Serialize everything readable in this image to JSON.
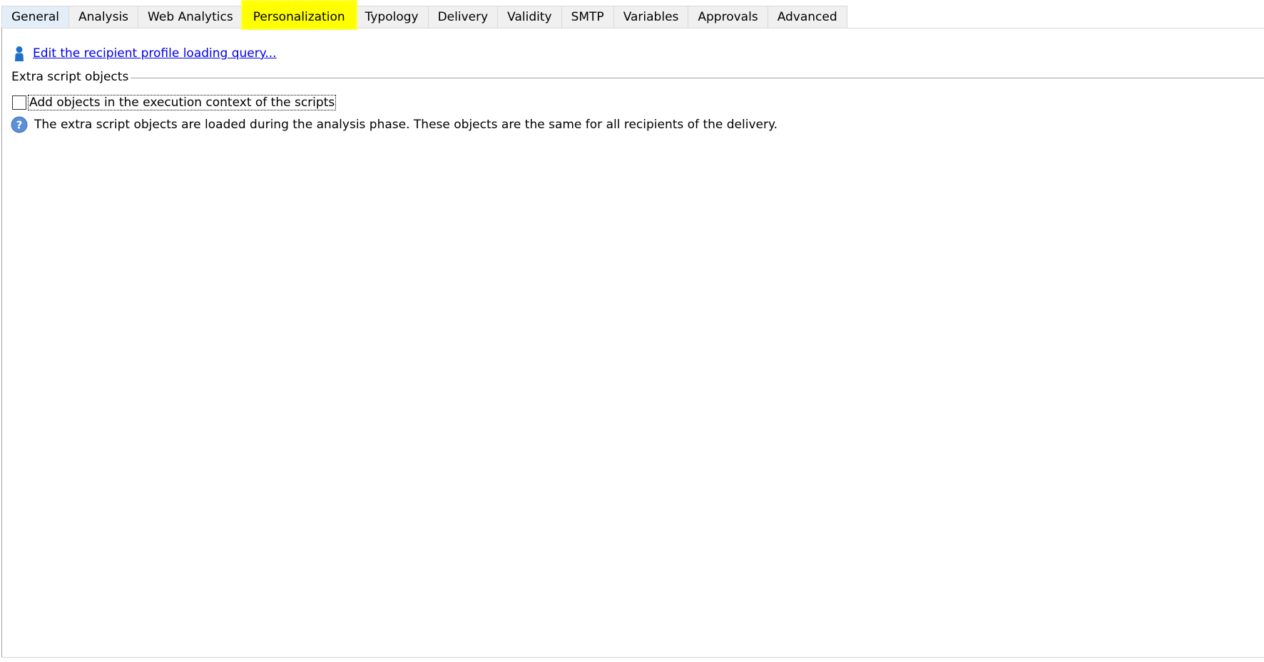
{
  "tabs": [
    {
      "label": "General"
    },
    {
      "label": "Analysis"
    },
    {
      "label": "Web Analytics"
    },
    {
      "label": "Personalization"
    },
    {
      "label": "Typology"
    },
    {
      "label": "Delivery"
    },
    {
      "label": "Validity"
    },
    {
      "label": "SMTP"
    },
    {
      "label": "Variables"
    },
    {
      "label": "Approvals"
    },
    {
      "label": "Advanced"
    }
  ],
  "active_tab": "Personalization",
  "highlight_color": "#ffff00",
  "personalization": {
    "link_icon": "person-icon",
    "edit_link_label": "Edit the recipient profile loading query...",
    "group_title": "Extra script objects",
    "checkbox_label": "Add objects in the execution context of the scripts",
    "checkbox_checked": false,
    "help_icon": "question-icon",
    "help_text": "The extra script objects are loaded during the analysis phase. These objects are the same for all recipients of the delivery."
  }
}
